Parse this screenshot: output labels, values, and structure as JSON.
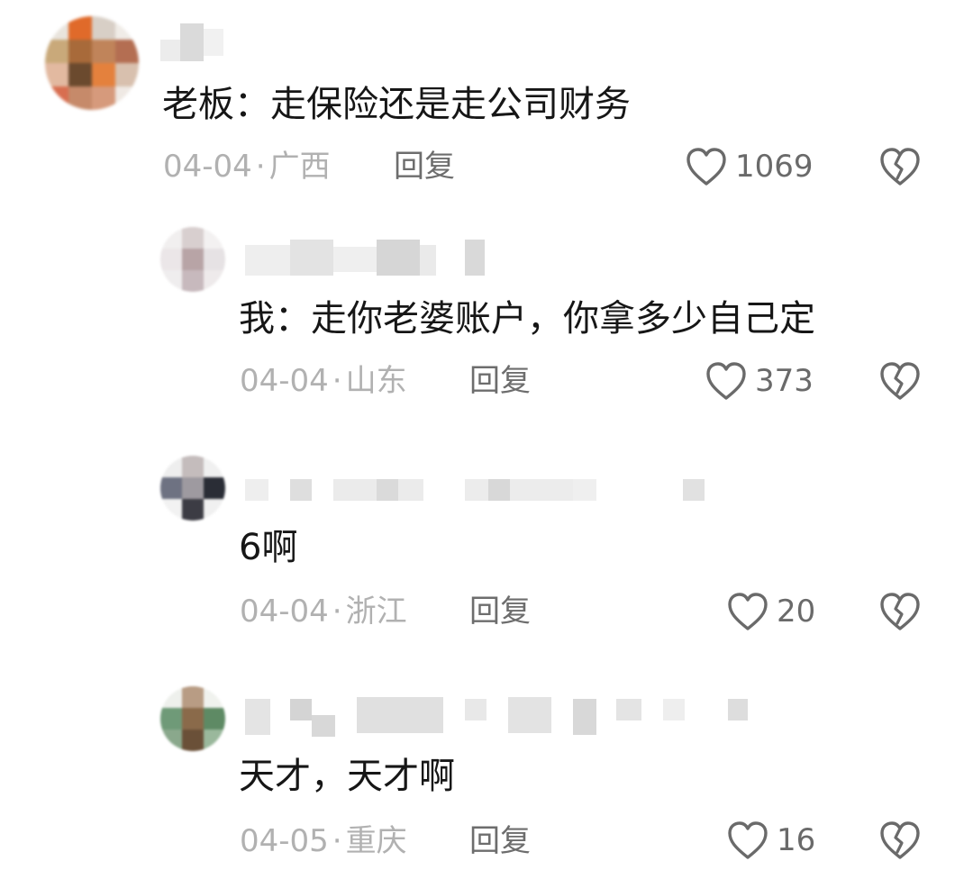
{
  "comments": [
    {
      "text": "老板：走保险还是走公司财务",
      "date": "04-04",
      "location": "广西",
      "reply_label": "回复",
      "likes": "1069",
      "reply_level": 0
    },
    {
      "text": "我：走你老婆账户，你拿多少自己定",
      "date": "04-04",
      "location": "山东",
      "reply_label": "回复",
      "likes": "373",
      "reply_level": 1
    },
    {
      "text": "6啊",
      "date": "04-04",
      "location": "浙江",
      "reply_label": "回复",
      "likes": "20",
      "reply_level": 1
    },
    {
      "text": "天才，天才啊",
      "date": "04-05",
      "location": "重庆",
      "reply_label": "回复",
      "likes": "16",
      "reply_level": 1
    }
  ],
  "icons": {
    "like": "heart-outline-icon",
    "dislike": "broken-heart-icon"
  },
  "colors": {
    "text": "#161616",
    "meta": "#b1b1b1",
    "reply": "#6d6d6d",
    "icon": "#6a6a6a"
  }
}
